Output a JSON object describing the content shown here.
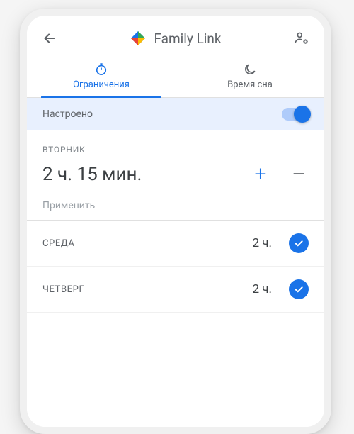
{
  "header": {
    "title": "Family Link"
  },
  "tabs": {
    "limits": "Ограничения",
    "bedtime": "Время сна"
  },
  "status": {
    "label": "Настроено",
    "toggle_on": true
  },
  "editor": {
    "day": "ВТОРНИК",
    "time": "2 ч. 15 мин.",
    "apply": "Применить"
  },
  "days": [
    {
      "name": "СРЕДА",
      "time": "2 ч.",
      "checked": true
    },
    {
      "name": "ЧЕТВЕРГ",
      "time": "2 ч.",
      "checked": true
    }
  ],
  "colors": {
    "primary": "#1a73e8",
    "bg_highlight": "#e8f0fe"
  }
}
